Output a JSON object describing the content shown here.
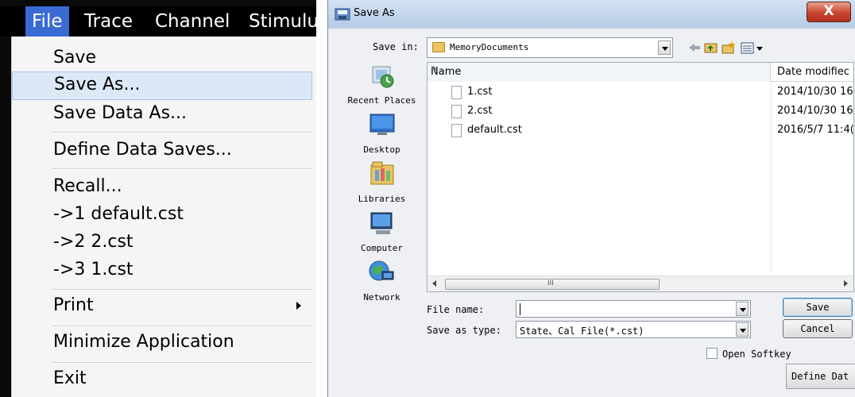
{
  "menubar": {
    "items": [
      "File",
      "Trace",
      "Channel",
      "Stimulu"
    ]
  },
  "file_menu": {
    "items": {
      "save": "Save",
      "save_as": "Save As...",
      "save_data_as": "Save Data As...",
      "define_data_saves": "Define Data Saves...",
      "recall": "Recall...",
      "recent_1": "->1 default.cst",
      "recent_2": "->2 2.cst",
      "recent_3": "->3 1.cst",
      "print": "Print",
      "minimize": "Minimize Application",
      "exit": "Exit"
    },
    "highlight_color": "#dce8f6"
  },
  "dialog": {
    "title": "Save As",
    "close_label": "X",
    "save_in_label": "Save in:",
    "save_in_value": "MemoryDocuments",
    "places": [
      "Recent Places",
      "Desktop",
      "Libraries",
      "Computer",
      "Network"
    ],
    "columns": {
      "name": "Name",
      "date": "Date modifiec"
    },
    "files": [
      {
        "name": "1.cst",
        "date": "2014/10/30 16"
      },
      {
        "name": "2.cst",
        "date": "2014/10/30 16"
      },
      {
        "name": "default.cst",
        "date": "2016/5/7 11:4("
      }
    ],
    "scroll_grip": "III",
    "file_name_label": "File name:",
    "file_name_value": "",
    "save_as_type_label": "Save as type:",
    "save_as_type_value": "State、Cal File(*.cst)",
    "save_button": "Save",
    "cancel_button": "Cancel",
    "open_softkey_label": "Open Softkey",
    "define_button": "Define Dat",
    "close_button_color": "#c8452e"
  }
}
